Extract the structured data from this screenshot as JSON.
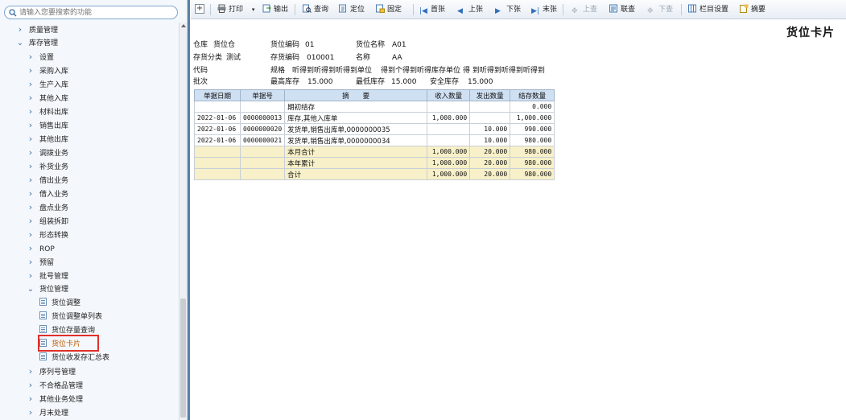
{
  "search": {
    "placeholder": "请输入您要搜索的功能"
  },
  "nav": {
    "items": [
      {
        "label": "质量管理",
        "expanded": false,
        "kind": "group"
      },
      {
        "label": "库存管理",
        "expanded": true,
        "kind": "group"
      },
      {
        "label": "设置",
        "kind": "sub"
      },
      {
        "label": "采购入库",
        "kind": "sub"
      },
      {
        "label": "生产入库",
        "kind": "sub"
      },
      {
        "label": "其他入库",
        "kind": "sub"
      },
      {
        "label": "材料出库",
        "kind": "sub"
      },
      {
        "label": "销售出库",
        "kind": "sub"
      },
      {
        "label": "其他出库",
        "kind": "sub"
      },
      {
        "label": "调拨业务",
        "kind": "sub"
      },
      {
        "label": "补货业务",
        "kind": "sub"
      },
      {
        "label": "借出业务",
        "kind": "sub"
      },
      {
        "label": "借入业务",
        "kind": "sub"
      },
      {
        "label": "盘点业务",
        "kind": "sub"
      },
      {
        "label": "组装拆卸",
        "kind": "sub"
      },
      {
        "label": "形态转换",
        "kind": "sub"
      },
      {
        "label": "ROP",
        "kind": "sub"
      },
      {
        "label": "预留",
        "kind": "sub"
      },
      {
        "label": "批号管理",
        "kind": "sub"
      },
      {
        "label": "货位管理",
        "kind": "sub-open"
      },
      {
        "label": "货位调整",
        "kind": "leaf"
      },
      {
        "label": "货位调整单列表",
        "kind": "leaf"
      },
      {
        "label": "货位存量查询",
        "kind": "leaf"
      },
      {
        "label": "货位卡片",
        "kind": "leaf",
        "selected": true
      },
      {
        "label": "货位收发存汇总表",
        "kind": "leaf"
      },
      {
        "label": "序列号管理",
        "kind": "sub"
      },
      {
        "label": "不合格品管理",
        "kind": "sub"
      },
      {
        "label": "其他业务处理",
        "kind": "sub"
      },
      {
        "label": "月末处理",
        "kind": "sub"
      }
    ]
  },
  "toolbar": {
    "add": "+",
    "print": "打印",
    "export": "输出",
    "query": "查询",
    "locate": "定位",
    "fix": "固定",
    "first": "首张",
    "prev": "上张",
    "next": "下张",
    "last": "末张",
    "up_query": "上查",
    "link_query": "联查",
    "down_query": "下查",
    "columns": "栏目设置",
    "summary": "摘要"
  },
  "report": {
    "title": "货位卡片",
    "header": {
      "warehouse_label": "仓库",
      "warehouse": "货位仓",
      "loc_code_label": "货位编码",
      "loc_code": "01",
      "loc_name_label": "货位名称",
      "loc_name": "A01",
      "inv_class_label": "存货分类",
      "inv_class": "测试",
      "inv_code_label": "存货编码",
      "inv_code": "010001",
      "name_label": "名称",
      "name": "AA",
      "code_label": "代码",
      "spec_label": "规格",
      "spec": "听得到听得到听得到单位",
      "spec_extra": "得到个得到听得库存单位",
      "spec_extra2": "得 到听得到听得到听得到",
      "batch_label": "批次",
      "max_stock_label": "最高库存",
      "max_stock": "15.000",
      "min_stock_label": "最低库存",
      "min_stock": "15.000",
      "safe_stock_label": "安全库存",
      "safe_stock": "15.000"
    },
    "columns": [
      "单据日期",
      "单据号",
      "摘　　要",
      "收入数量",
      "发出数量",
      "结存数量"
    ],
    "rows": [
      {
        "date": "",
        "no": "",
        "summary": "期初结存",
        "in": "",
        "out": "",
        "balance": "0.000",
        "total": false
      },
      {
        "date": "2022-01-06",
        "no": "0000000013",
        "summary": "库存,其他入库单",
        "in": "1,000.000",
        "out": "",
        "balance": "1,000.000",
        "total": false
      },
      {
        "date": "2022-01-06",
        "no": "0000000020",
        "summary": "发货单,销售出库单,0000000035",
        "in": "",
        "out": "10.000",
        "balance": "990.000",
        "total": false
      },
      {
        "date": "2022-01-06",
        "no": "0000000021",
        "summary": "发货单,销售出库单,0000000034",
        "in": "",
        "out": "10.000",
        "balance": "980.000",
        "total": false
      },
      {
        "date": "",
        "no": "",
        "summary": "本月合计",
        "in": "1,000.000",
        "out": "20.000",
        "balance": "980.000",
        "total": true
      },
      {
        "date": "",
        "no": "",
        "summary": "本年累计",
        "in": "1,000.000",
        "out": "20.000",
        "balance": "980.000",
        "total": true
      },
      {
        "date": "",
        "no": "",
        "summary": "合计",
        "in": "1,000.000",
        "out": "20.000",
        "balance": "980.000",
        "total": true
      }
    ]
  }
}
